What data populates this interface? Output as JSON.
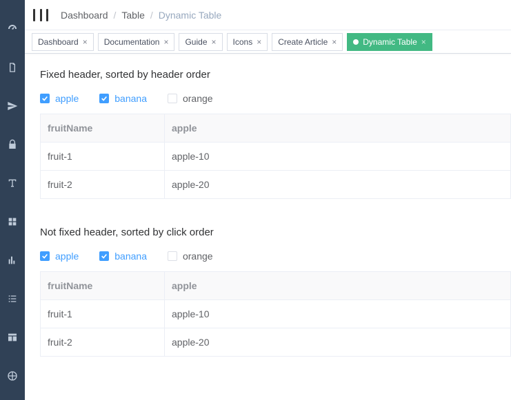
{
  "breadcrumb": {
    "items": [
      {
        "label": "Dashboard",
        "last": false
      },
      {
        "label": "Table",
        "last": false
      },
      {
        "label": "Dynamic Table",
        "last": true
      }
    ]
  },
  "tabs": [
    {
      "label": "Dashboard",
      "active": false,
      "closable": true
    },
    {
      "label": "Documentation",
      "active": false,
      "closable": true
    },
    {
      "label": "Guide",
      "active": false,
      "closable": true
    },
    {
      "label": "Icons",
      "active": false,
      "closable": true
    },
    {
      "label": "Create Article",
      "active": false,
      "closable": true
    },
    {
      "label": "Dynamic Table",
      "active": true,
      "closable": true
    }
  ],
  "sections": [
    {
      "title": "Fixed header, sorted by header order",
      "checks": [
        {
          "label": "apple",
          "checked": true
        },
        {
          "label": "banana",
          "checked": true
        },
        {
          "label": "orange",
          "checked": false
        }
      ],
      "columns": [
        "fruitName",
        "apple"
      ],
      "rows": [
        [
          "fruit-1",
          "apple-10"
        ],
        [
          "fruit-2",
          "apple-20"
        ]
      ]
    },
    {
      "title": "Not fixed header, sorted by click order",
      "checks": [
        {
          "label": "apple",
          "checked": true
        },
        {
          "label": "banana",
          "checked": true
        },
        {
          "label": "orange",
          "checked": false
        }
      ],
      "columns": [
        "fruitName",
        "apple"
      ],
      "rows": [
        [
          "fruit-1",
          "apple-10"
        ],
        [
          "fruit-2",
          "apple-20"
        ]
      ]
    }
  ],
  "sidebar_icons": [
    "dashboard-icon",
    "document-icon",
    "send-icon",
    "lock-icon",
    "text-icon",
    "components-icon",
    "chart-icon",
    "list-icon",
    "table-icon",
    "crosshair-icon"
  ]
}
